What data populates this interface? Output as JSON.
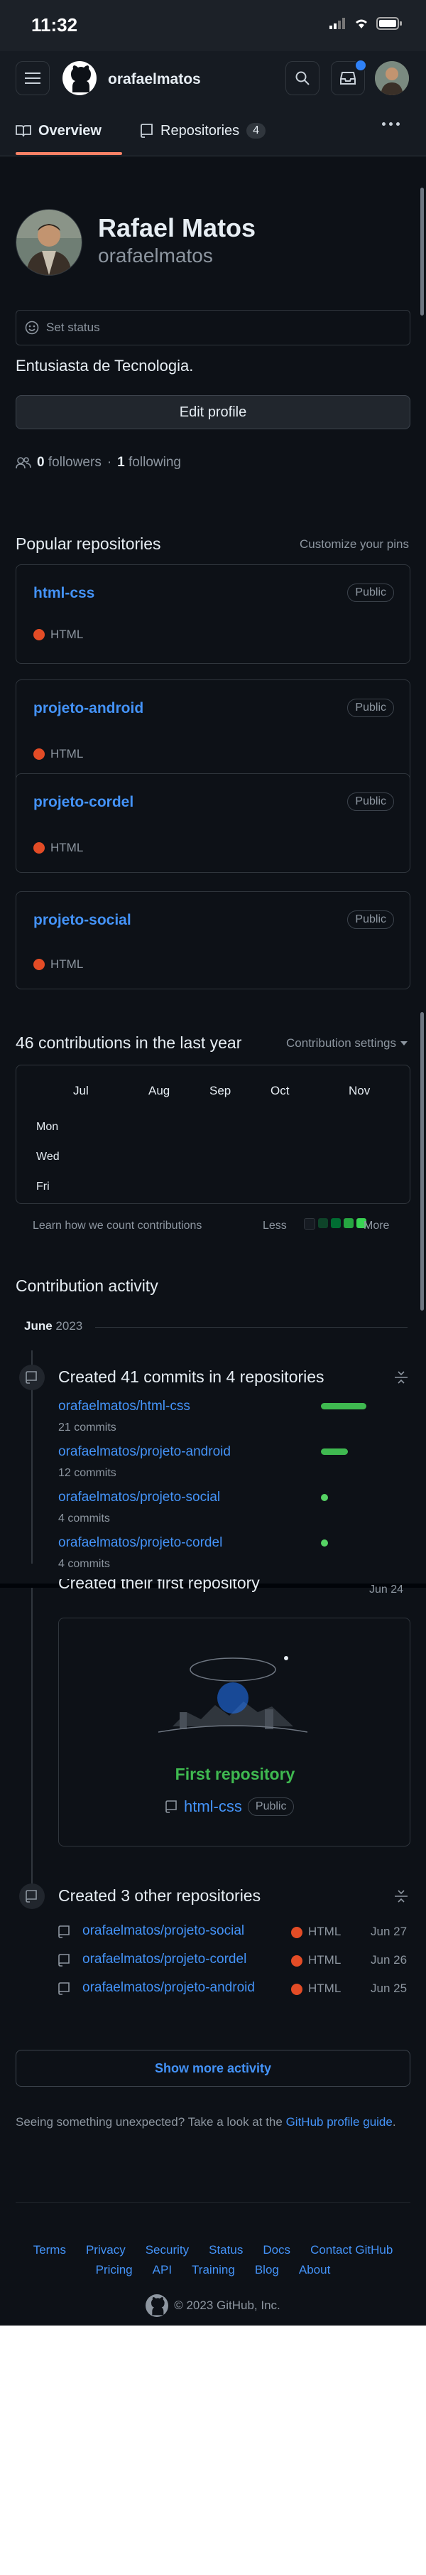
{
  "status_bar": {
    "time": "11:32"
  },
  "header": {
    "username": "orafaelmatos"
  },
  "tabs": {
    "overview": "Overview",
    "repositories": "Repositories",
    "repo_count": "4"
  },
  "profile": {
    "name": "Rafael Matos",
    "login": "orafaelmatos",
    "status_placeholder": "Set status",
    "bio": "Entusiasta de Tecnologia.",
    "edit_label": "Edit profile",
    "followers_count": "0",
    "followers_label": "followers",
    "sep": "·",
    "following_count": "1",
    "following_label": "following"
  },
  "popular": {
    "title": "Popular repositories",
    "customize": "Customize your pins",
    "repos": [
      {
        "name": "html-css",
        "visibility": "Public",
        "language": "HTML"
      },
      {
        "name": "projeto-android",
        "visibility": "Public",
        "language": "HTML"
      },
      {
        "name": "projeto-cordel",
        "visibility": "Public",
        "language": "HTML"
      },
      {
        "name": "projeto-social",
        "visibility": "Public",
        "language": "HTML"
      }
    ]
  },
  "contributions": {
    "title": "46 contributions in the last year",
    "settings": "Contribution settings",
    "months": [
      "Jul",
      "Aug",
      "Sep",
      "Oct",
      "Nov"
    ],
    "days": [
      "Mon",
      "Wed",
      "Fri"
    ],
    "learn": "Learn how we count contributions",
    "less": "Less",
    "more": "More",
    "legend_colors": [
      "#161b22",
      "#0e4429",
      "#006d32",
      "#26a641",
      "#39d353"
    ]
  },
  "activity": {
    "title": "Contribution activity",
    "month": "June",
    "year": "2023",
    "commits": {
      "title": "Created 41 commits in 4 repositories",
      "items": [
        {
          "repo": "orafaelmatos/html-css",
          "count": "21 commits",
          "share": 0.51
        },
        {
          "repo": "orafaelmatos/projeto-android",
          "count": "12 commits",
          "share": 0.29
        },
        {
          "repo": "orafaelmatos/projeto-social",
          "count": "4 commits",
          "share": 0.1
        },
        {
          "repo": "orafaelmatos/projeto-cordel",
          "count": "4 commits",
          "share": 0.1
        }
      ]
    },
    "first_repo": {
      "title": "Created their first repository",
      "date": "Jun 24",
      "heading": "First repository",
      "repo": "html-css",
      "visibility": "Public"
    },
    "other": {
      "title": "Created 3 other repositories",
      "items": [
        {
          "repo": "orafaelmatos/projeto-social",
          "language": "HTML",
          "date": "Jun 27"
        },
        {
          "repo": "orafaelmatos/projeto-cordel",
          "language": "HTML",
          "date": "Jun 26"
        },
        {
          "repo": "orafaelmatos/projeto-android",
          "language": "HTML",
          "date": "Jun 25"
        }
      ]
    },
    "show_more": "Show more activity"
  },
  "feedback": {
    "text": "Seeing something unexpected? Take a look at the ",
    "link": "GitHub profile guide",
    "end": "."
  },
  "footer": {
    "row1": [
      "Terms",
      "Privacy",
      "Security",
      "Status",
      "Docs",
      "Contact GitHub"
    ],
    "row2": [
      "Pricing",
      "API",
      "Training",
      "Blog",
      "About"
    ],
    "copyright": "© 2023 GitHub, Inc."
  },
  "colors": {
    "accent": "#4493f8",
    "green": "#3fb950",
    "html": "#e34c26",
    "bg": "#0d1117"
  }
}
